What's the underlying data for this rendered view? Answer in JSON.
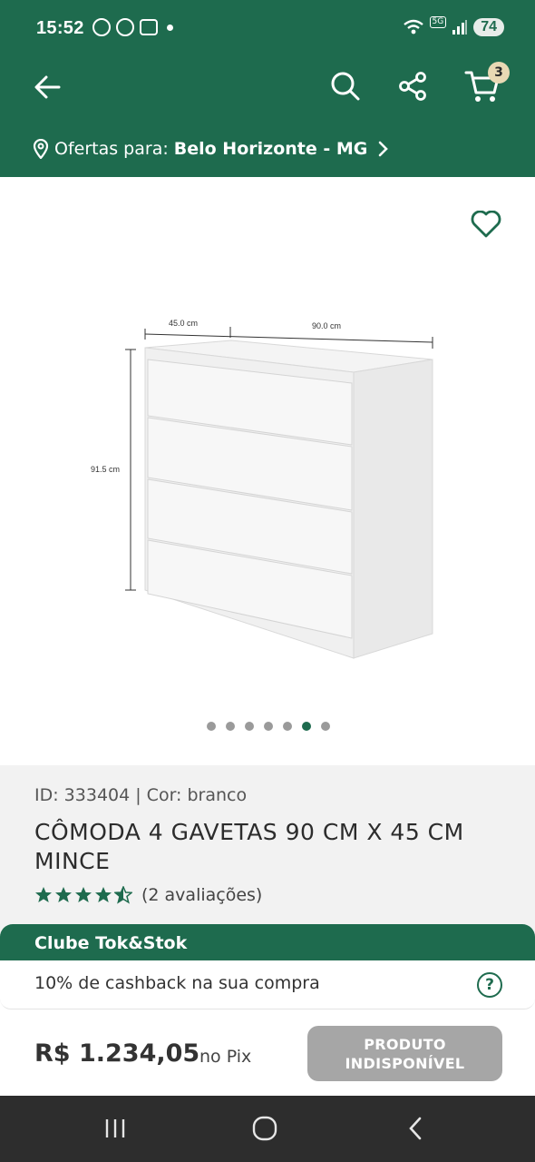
{
  "status_bar": {
    "time": "15:52",
    "network": "5G",
    "battery": "74"
  },
  "header": {
    "back_icon": "arrow-left-icon",
    "search_icon": "search-icon",
    "share_icon": "share-icon",
    "cart_icon": "cart-icon",
    "cart_count": "3"
  },
  "location": {
    "label": "Ofertas para:",
    "city": "Belo Horizonte - MG"
  },
  "product": {
    "image_labels": {
      "depth": "45.0 cm",
      "width": "90.0 cm",
      "height": "91.5 cm"
    },
    "carousel": {
      "total": 7,
      "active_index": 5
    },
    "meta": "ID: 333404 | Cor: branco",
    "title": "CÔMODA 4 GAVETAS 90 CM X 45 CM MINCE",
    "rating_stars": 4.5,
    "reviews": "(2 avaliações)"
  },
  "clube": {
    "title": "Clube Tok&Stok",
    "cashback": "10% de cashback na sua compra",
    "help_icon": "?"
  },
  "buy": {
    "price": "R$ 1.234,05",
    "price_suffix": "no Pix",
    "button_line1": "PRODUTO",
    "button_line2": "INDISPONÍVEL"
  },
  "colors": {
    "brand_green": "#1e6b4e",
    "disabled_gray": "#a6a6a6",
    "badge_beige": "#e8d9b4"
  }
}
